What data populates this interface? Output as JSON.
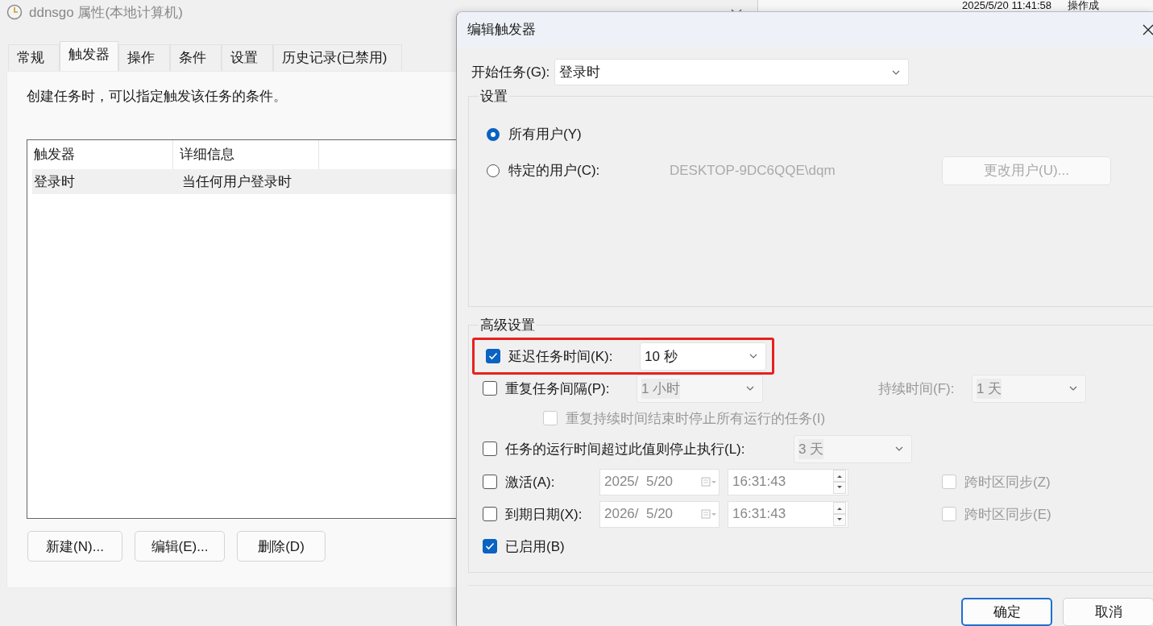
{
  "background_window": {
    "timestamp": "2025/5/20 11:41:58",
    "column_2": "操作成"
  },
  "properties_window": {
    "title": "ddnsgo 属性(本地计算机)",
    "tabs": [
      {
        "label": "常规",
        "selected": false
      },
      {
        "label": "触发器",
        "selected": true
      },
      {
        "label": "操作",
        "selected": false
      },
      {
        "label": "条件",
        "selected": false
      },
      {
        "label": "设置",
        "selected": false
      },
      {
        "label": "历史记录(已禁用)",
        "selected": false
      }
    ],
    "description": "创建任务时，可以指定触发该任务的条件。",
    "table": {
      "columns": [
        "触发器",
        "详细信息"
      ],
      "rows": [
        {
          "cells": [
            "登录时",
            "当任何用户登录时"
          ],
          "selected": true
        }
      ]
    },
    "buttons": [
      "新建(N)...",
      "编辑(E)...",
      "删除(D)"
    ]
  },
  "dialog": {
    "title": "编辑触发器",
    "begin_task": {
      "label": "开始任务(G):",
      "value": "登录时"
    },
    "settings": {
      "title": "设置",
      "options": [
        {
          "label": "所有用户(Y)",
          "selected": true
        },
        {
          "label": "特定的用户(C):",
          "selected": false,
          "user": "DESKTOP-9DC6QQE\\dqm",
          "button": "更改用户(U)..."
        }
      ]
    },
    "advanced": {
      "title": "高级设置",
      "rows": [
        {
          "kind": "select",
          "label": "延迟任务时间(K):",
          "checked": true,
          "value": "10 秒",
          "highlighted": true
        },
        {
          "kind": "repeat",
          "label": "重复任务间隔(P):",
          "checked": false,
          "value": "1 小时",
          "duration_label": "持续时间(F):",
          "duration_value": "1 天"
        },
        {
          "kind": "sub",
          "label": "重复持续时间结束时停止所有运行的任务(I)",
          "checked": false
        },
        {
          "kind": "limit",
          "label": "任务的运行时间超过此值则停止执行(L):",
          "checked": false,
          "value": "3 天"
        },
        {
          "kind": "datetime",
          "label": "激活(A):",
          "checked": false,
          "date": "2025/  5/20",
          "time": "16:31:43",
          "sync_label": "跨时区同步(Z)",
          "sync_checked": false
        },
        {
          "kind": "datetime",
          "label": "到期日期(X):",
          "checked": false,
          "date": "2026/  5/20",
          "time": "16:31:43",
          "sync_label": "跨时区同步(E)",
          "sync_checked": false
        },
        {
          "kind": "plain",
          "label": "已启用(B)",
          "checked": true
        }
      ]
    },
    "buttons": [
      {
        "label": "确定",
        "default": true
      },
      {
        "label": "取消",
        "default": false
      }
    ]
  }
}
